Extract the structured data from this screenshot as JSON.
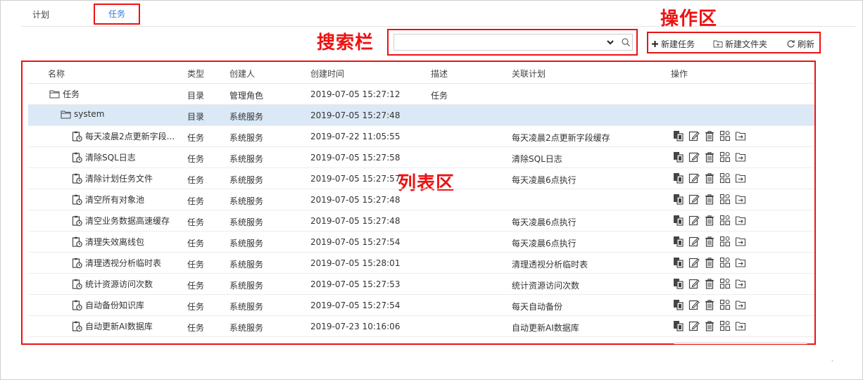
{
  "tabs": [
    {
      "label": "计划"
    },
    {
      "label": "任务"
    }
  ],
  "callouts": {
    "search": "搜索栏",
    "ops": "操作区",
    "list": "列表区"
  },
  "search": {
    "value": "",
    "placeholder": ""
  },
  "toolbar": {
    "new_task": "新建任务",
    "new_folder": "新建文件夹",
    "refresh": "刷新"
  },
  "columns": {
    "name": "名称",
    "type": "类型",
    "creator": "创建人",
    "time": "创建时间",
    "desc": "描述",
    "plan": "关联计划",
    "ops": "操作"
  },
  "rows": [
    {
      "kind": "folder",
      "level": 0,
      "name": "任务",
      "type": "目录",
      "creator": "管理角色",
      "time": "2019-07-05 15:27:12",
      "desc": "任务",
      "plan": ""
    },
    {
      "kind": "folder",
      "level": 1,
      "name": "system",
      "type": "目录",
      "creator": "系统服务",
      "time": "2019-07-05 15:27:48",
      "desc": "",
      "plan": "",
      "selected": true
    },
    {
      "kind": "task",
      "level": 2,
      "name": "每天凌晨2点更新字段...",
      "type": "任务",
      "creator": "系统服务",
      "time": "2019-07-22 11:05:55",
      "desc": "",
      "plan": "每天凌晨2点更新字段缓存"
    },
    {
      "kind": "task",
      "level": 2,
      "name": "清除SQL日志",
      "type": "任务",
      "creator": "系统服务",
      "time": "2019-07-05 15:27:58",
      "desc": "",
      "plan": "清除SQL日志"
    },
    {
      "kind": "task",
      "level": 2,
      "name": "清除计划任务文件",
      "type": "任务",
      "creator": "系统服务",
      "time": "2019-07-05 15:27:57",
      "desc": "",
      "plan": "每天凌晨6点执行"
    },
    {
      "kind": "task",
      "level": 2,
      "name": "清空所有对象池",
      "type": "任务",
      "creator": "系统服务",
      "time": "2019-07-05 15:27:48",
      "desc": "",
      "plan": ""
    },
    {
      "kind": "task",
      "level": 2,
      "name": "清空业务数据高速缓存",
      "type": "任务",
      "creator": "系统服务",
      "time": "2019-07-05 15:27:48",
      "desc": "",
      "plan": "每天凌晨6点执行"
    },
    {
      "kind": "task",
      "level": 2,
      "name": "清理失效离线包",
      "type": "任务",
      "creator": "系统服务",
      "time": "2019-07-05 15:27:54",
      "desc": "",
      "plan": "每天凌晨6点执行"
    },
    {
      "kind": "task",
      "level": 2,
      "name": "清理透视分析临时表",
      "type": "任务",
      "creator": "系统服务",
      "time": "2019-07-05 15:28:01",
      "desc": "",
      "plan": "清理透视分析临时表"
    },
    {
      "kind": "task",
      "level": 2,
      "name": "统计资源访问次数",
      "type": "任务",
      "creator": "系统服务",
      "time": "2019-07-05 15:27:53",
      "desc": "",
      "plan": "统计资源访问次数"
    },
    {
      "kind": "task",
      "level": 2,
      "name": "自动备份知识库",
      "type": "任务",
      "creator": "系统服务",
      "time": "2019-07-05 15:27:54",
      "desc": "",
      "plan": "每天自动备份"
    },
    {
      "kind": "task",
      "level": 2,
      "name": "自动更新AI数据库",
      "type": "任务",
      "creator": "系统服务",
      "time": "2019-07-23 10:16:06",
      "desc": "",
      "plan": "自动更新AI数据库"
    }
  ],
  "icons": {
    "folder": "folder-icon",
    "task": "task-clock-icon",
    "actions": [
      "copy-icon",
      "edit-icon",
      "delete-icon",
      "permission-icon",
      "move-icon"
    ]
  },
  "colors": {
    "accent": "#2f7fd8",
    "annotation": "#e11111",
    "selected_row": "#dbe8f6"
  },
  "footer_mark": "'"
}
